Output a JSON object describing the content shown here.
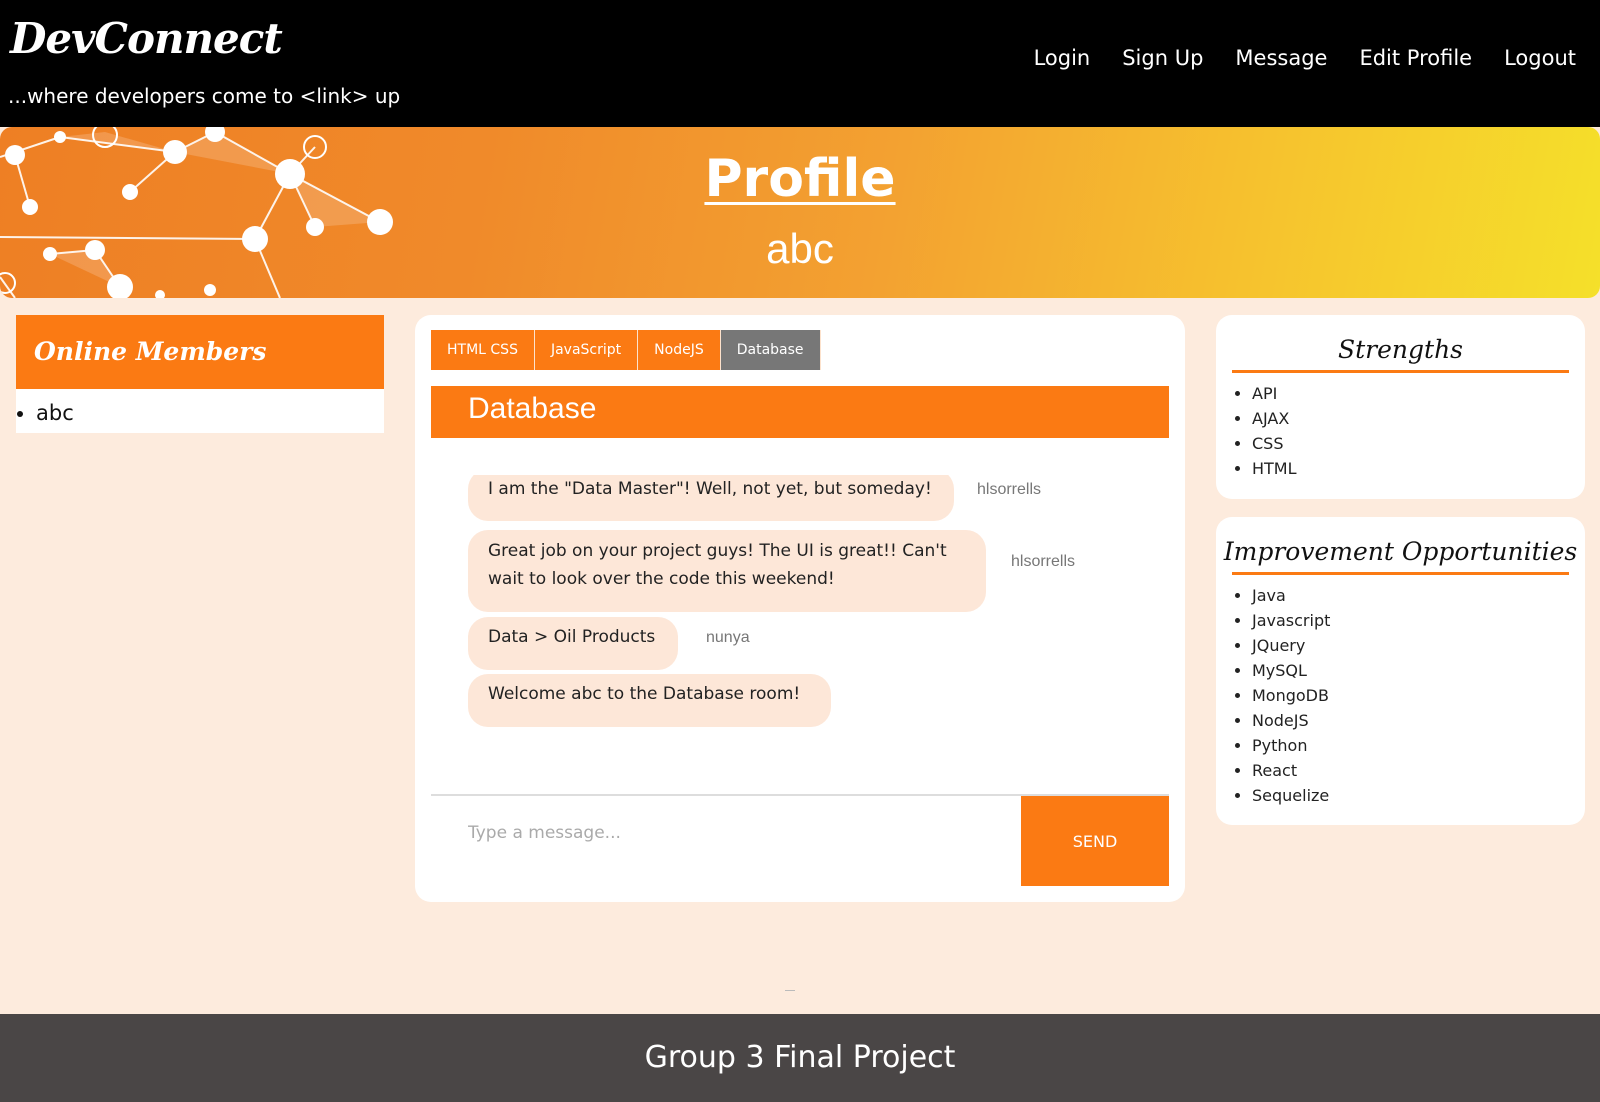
{
  "brand": {
    "name": "DevConnect",
    "tagline": "...where developers come to <link> up"
  },
  "nav": [
    "Login",
    "Sign Up",
    "Message",
    "Edit Profile",
    "Logout"
  ],
  "banner": {
    "title": "Profile",
    "username": "abc"
  },
  "online_members": {
    "title": "Online Members",
    "members": [
      "abc"
    ]
  },
  "chat": {
    "tabs": [
      {
        "label": "HTML CSS",
        "active": false
      },
      {
        "label": "JavaScript",
        "active": false
      },
      {
        "label": "NodeJS",
        "active": false
      },
      {
        "label": "Database",
        "active": true
      }
    ],
    "room_title": "Database",
    "messages": [
      {
        "text": "I am the \"Data Master\"! Well, not yet, but someday!",
        "user": "hlsorrells"
      },
      {
        "text": "Great job on your project guys! The UI is great!! Can't wait to look over the code this weekend!",
        "user": "hlsorrells"
      },
      {
        "text": "Data > Oil Products",
        "user": "nunya"
      },
      {
        "text": "Welcome abc to the Database room!",
        "user": ""
      }
    ],
    "input_placeholder": "Type a message...",
    "send_label": "SEND"
  },
  "strengths": {
    "title": "Strengths",
    "items": [
      "API",
      "AJAX",
      "CSS",
      "HTML"
    ]
  },
  "improvements": {
    "title": "Improvement Opportunities",
    "items": [
      "Java",
      "Javascript",
      "JQuery",
      "MySQL",
      "MongoDB",
      "NodeJS",
      "Python",
      "React",
      "Sequelize"
    ]
  },
  "footer": {
    "text": "Group 3 Final Project"
  },
  "colors": {
    "accent": "#fb7a13",
    "background": "#fdebdd",
    "navbar": "#000000",
    "footer": "#4a4646",
    "active_tab": "#777777",
    "bubble": "#fde7d8"
  }
}
